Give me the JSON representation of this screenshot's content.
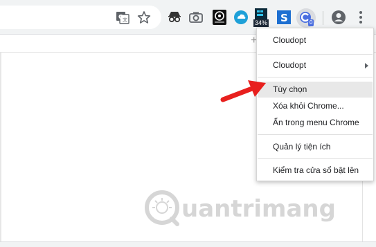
{
  "toolbar": {
    "extension_badge_percent": "34%",
    "extension_badge_count": "0",
    "new_tab_plus": "+"
  },
  "menu": {
    "items": [
      {
        "label": "Cloudopt"
      },
      {
        "label": "Cloudopt",
        "has_submenu": true
      },
      {
        "label": "Tùy chọn",
        "highlighted": true
      },
      {
        "label": "Xóa khỏi Chrome..."
      },
      {
        "label": "Ẩn trong menu Chrome"
      },
      {
        "label": "Quản lý tiện ích"
      },
      {
        "label": "Kiểm tra cửa sổ bật lên"
      }
    ]
  },
  "watermark": {
    "text": "uantrimang"
  },
  "colors": {
    "arrow": "#e8201e",
    "cloudopt_accent": "#4a6ee0",
    "menu_highlight": "#e8e8e8"
  },
  "icons": [
    "translate-icon",
    "star-icon",
    "incognito-extension-icon",
    "camera-icon",
    "media-extension-icon",
    "cloud-extension-icon",
    "meter-extension-icon",
    "s-extension-icon",
    "cloudopt-extension-icon",
    "account-icon",
    "more-menu-icon"
  ]
}
